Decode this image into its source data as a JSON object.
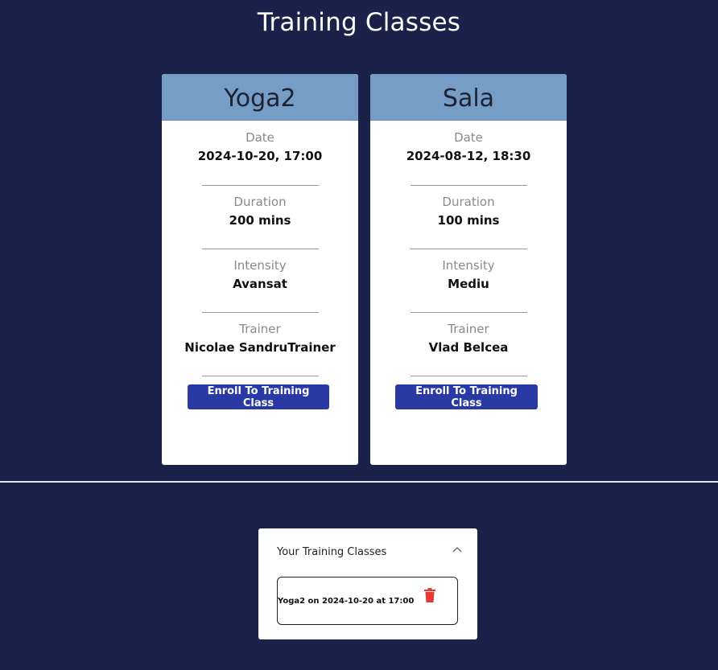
{
  "page": {
    "title": "Training Classes"
  },
  "labels": {
    "date": "Date",
    "duration": "Duration",
    "intensity": "Intensity",
    "trainer": "Trainer",
    "enroll": "Enroll To Training Class"
  },
  "classes": [
    {
      "name": "Yoga2",
      "date": "2024-10-20, 17:00",
      "duration": "200 mins",
      "intensity": "Avansat",
      "trainer": "Nicolae SandruTrainer"
    },
    {
      "name": "Sala",
      "date": "2024-08-12, 18:30",
      "duration": "100 mins",
      "intensity": "Mediu",
      "trainer": "Vlad Belcea"
    }
  ],
  "my_classes": {
    "title": "Your Training Classes",
    "items": [
      {
        "text": "Yoga2 on 2024-10-20 at 17:00"
      }
    ]
  },
  "colors": {
    "background": "#1a2249",
    "card_header": "#769dc6",
    "button": "#2a3aa4",
    "delete": "#e53935"
  },
  "icons": {
    "collapse": "chevron-up-icon",
    "delete": "trash-icon"
  }
}
